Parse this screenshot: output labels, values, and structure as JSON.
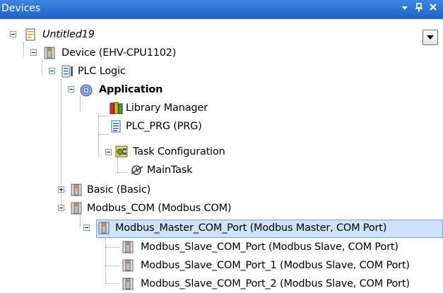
{
  "panel": {
    "title": "Devices",
    "menu_icon": "dropdown-arrow-icon",
    "pin_icon": "pin-icon",
    "close_icon": "close-icon"
  },
  "tree": {
    "project": "Untitled19",
    "device": "Device (EHV-CPU1102)",
    "plc_logic": "PLC Logic",
    "application": "Application",
    "library_manager": "Library Manager",
    "plc_prg": "PLC_PRG (PRG)",
    "task_configuration": "Task Configuration",
    "main_task": "MainTask",
    "basic": "Basic (Basic)",
    "modbus_com": "Modbus_COM (Modbus COM)",
    "master_port": "Modbus_Master_COM_Port (Modbus Master, COM Port)",
    "slave_0": "Modbus_Slave_COM_Port (Modbus Slave, COM Port)",
    "slave_1": "Modbus_Slave_COM_Port_1 (Modbus Slave, COM Port)",
    "slave_2": "Modbus_Slave_COM_Port_2 (Modbus Slave, COM Port)"
  },
  "colors": {
    "titlebar": "#1d62c8",
    "selection": "#cfe2fb"
  }
}
